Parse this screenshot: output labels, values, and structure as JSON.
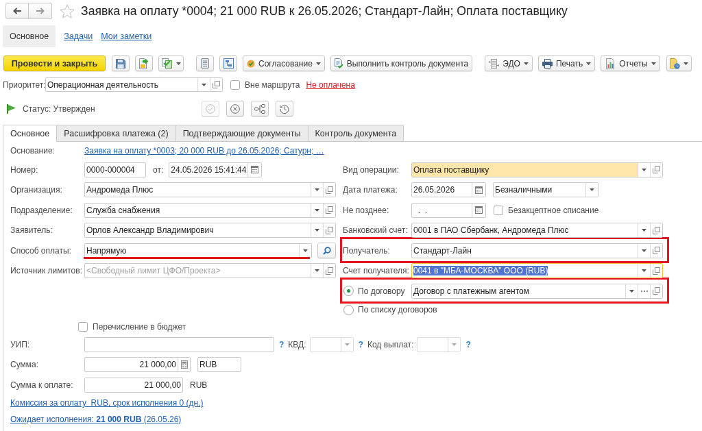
{
  "window": {
    "title": "Заявка на оплату *0004; 21 000 RUB к 26.05.2026; Стандарт-Лайн; Оплата поставщику"
  },
  "section_tabs": [
    {
      "label": "Основное",
      "selected": true
    },
    {
      "label": "Задачи",
      "selected": false
    },
    {
      "label": "Мои заметки",
      "selected": false
    }
  ],
  "toolbar": {
    "primary_button": "Провести и закрыть",
    "actions": [
      {
        "label": "Согласование",
        "dropdown": true
      },
      {
        "label": "Выполнить контроль документа",
        "dropdown": false
      }
    ],
    "menus": [
      {
        "label": "ЭДО",
        "dropdown": true
      },
      {
        "label": "Печать",
        "dropdown": true
      },
      {
        "label": "Отчеты",
        "dropdown": true
      }
    ]
  },
  "priority": {
    "label": "Приоритет:",
    "value": "Операционная деятельность"
  },
  "out_of_route": {
    "label": "Вне маршрута",
    "checked": false
  },
  "payment_status": "Не оплачена",
  "status": {
    "text": "Статус: Утвержден",
    "actions": [
      {
        "disabled": true
      },
      {
        "disabled": false
      },
      {
        "disabled": false
      },
      {
        "disabled": false
      }
    ]
  },
  "form_tabs": [
    {
      "label": "Основное",
      "selected": true
    },
    {
      "label": "Расшифровка платежа (2)",
      "selected": false
    },
    {
      "label": "Подтверждающие документы",
      "selected": false
    },
    {
      "label": "Контроль документа",
      "selected": false
    }
  ],
  "basis": {
    "label": "Основание:",
    "value": "Заявка на оплату *0003; 20 000 RUB до 26.05.2026; Сатурн; …"
  },
  "left_fields": [
    {
      "kind": "number",
      "label": "Номер:",
      "value": "0000-000004",
      "date_label": "от:",
      "date": "24.05.2026 15:41:44",
      "underlined": false
    },
    {
      "kind": "combo",
      "label": "Организация:",
      "value": "Андромеда Плюс",
      "underlined": false
    },
    {
      "kind": "combo",
      "label": "Подразделение:",
      "value": "Служба снабжения",
      "underlined": false
    },
    {
      "kind": "combo",
      "label": "Заявитель:",
      "value": "Орлов Александр Владимирович",
      "underlined": false
    },
    {
      "kind": "choice",
      "label": "Способ оплаты:",
      "value": "Напрямую",
      "underlined": true
    },
    {
      "kind": "combo",
      "label": "Источник лимитов:",
      "placeholder": "<Свободный лимит ЦФО/Проекта>",
      "underlined": false
    }
  ],
  "right_fields": [
    {
      "kind": "combo",
      "label": "Вид операции:",
      "value": "Оплата поставщику",
      "accent": true,
      "focused": false,
      "highlighted": false
    },
    {
      "kind": "date_select",
      "label": "Дата платежа:",
      "value": "26.05.2026",
      "option": "Безналичными",
      "accent": false,
      "focused": false,
      "highlighted": false
    },
    {
      "kind": "date_check",
      "label": "Не позднее:",
      "value": "  .  .",
      "check_label": "Безакцептное списание",
      "checked": false,
      "accent": false,
      "focused": false,
      "highlighted": false
    },
    {
      "kind": "combo",
      "label": "Банковский счет:",
      "value": "0001 в ПАО Сбербанк, Андромеда Плюс",
      "accent": false,
      "focused": false,
      "highlighted": false
    },
    {
      "kind": "combo",
      "label": "Получатель:",
      "value": "Стандарт-Лайн",
      "accent": false,
      "focused": false,
      "highlighted": true
    },
    {
      "kind": "combo",
      "label": "Счет получателя:",
      "value": "0041 в \"МБА-МОСКВА\" ООО (RUB)",
      "accent": false,
      "focused": true,
      "highlighted": false
    }
  ],
  "contract": {
    "options": [
      {
        "label": "По договору",
        "selected": true
      },
      {
        "label": "По списку договоров",
        "selected": false
      }
    ],
    "value": "Договор с платежным агентом",
    "highlighted": true
  },
  "budget_transfer": {
    "label": "Перечисление в бюджет",
    "checked": false
  },
  "tax_codes": [
    {
      "kind": "text",
      "label": "УИП:",
      "help": "?"
    },
    {
      "kind": "select",
      "label": "КВД:",
      "help": "?"
    },
    {
      "kind": "select",
      "label": "Код выплат:",
      "help": "?"
    }
  ],
  "amount": {
    "label": "Сумма:",
    "value": "21 000,00",
    "currency": "RUB"
  },
  "amount_to_pay": {
    "label": "Сумма к оплате:",
    "value": "21 000,00",
    "currency": "RUB"
  },
  "links": [
    "Комиссия за оплату  RUB, срок исполнения 0 (дн.)",
    "Ожидает исполнения: **21 000 RUB** (26.05.26)"
  ]
}
